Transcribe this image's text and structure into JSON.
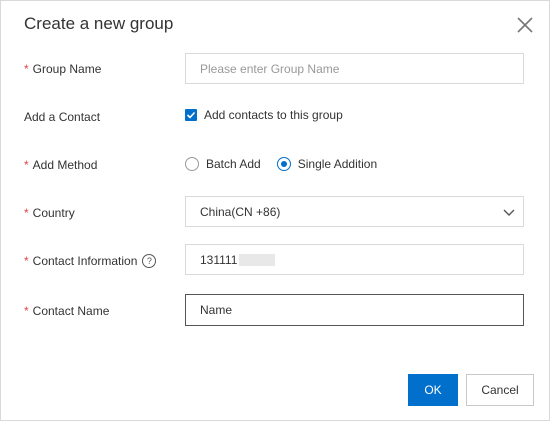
{
  "dialog": {
    "title": "Create a new group"
  },
  "form": {
    "group_name": {
      "label": "Group Name",
      "required_mark": "*",
      "value": "",
      "placeholder": "Please enter Group Name"
    },
    "add_contact": {
      "label": "Add a Contact",
      "checkbox_label": "Add contacts to this group",
      "checked": true
    },
    "add_method": {
      "label": "Add Method",
      "required_mark": "*",
      "options": [
        {
          "label": "Batch Add",
          "selected": false
        },
        {
          "label": "Single Addition",
          "selected": true
        }
      ]
    },
    "country": {
      "label": "Country",
      "required_mark": "*",
      "value": "China(CN +86)"
    },
    "contact_information": {
      "label": "Contact Information",
      "required_mark": "*",
      "help_glyph": "?",
      "value": "131111"
    },
    "contact_name": {
      "label": "Contact Name",
      "required_mark": "*",
      "value": "Name"
    }
  },
  "buttons": {
    "ok": "OK",
    "cancel": "Cancel"
  },
  "colors": {
    "primary": "#0070cc",
    "required": "#e54545",
    "border": "#d9d9d9"
  }
}
